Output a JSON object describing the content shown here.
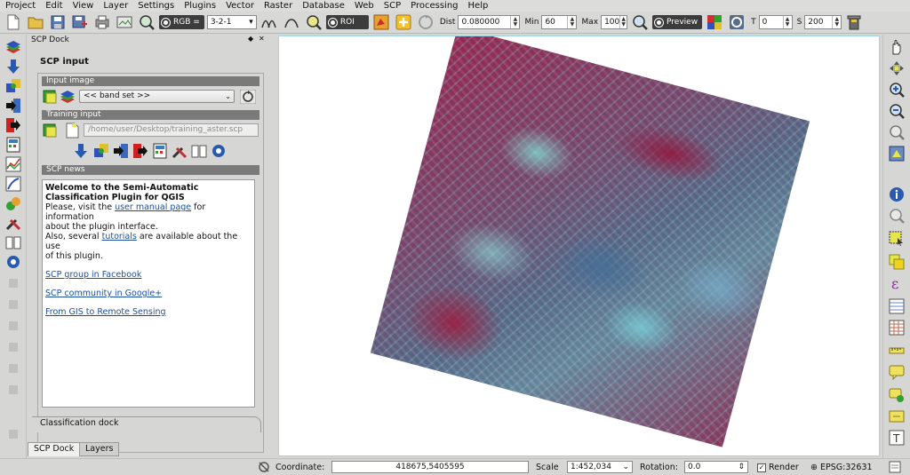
{
  "menu": [
    "Project",
    "Edit",
    "View",
    "Layer",
    "Settings",
    "Plugins",
    "Vector",
    "Raster",
    "Database",
    "Web",
    "SCP",
    "Processing",
    "Help"
  ],
  "toolbar": {
    "rgb_label": "RGB =",
    "rgb_value": "3-2-1",
    "roi_label": "ROI",
    "dist_label": "Dist",
    "dist_value": "0.080000",
    "min_label": "Min",
    "min_value": "60",
    "max_label": "Max",
    "max_value": "100",
    "preview_label": "Preview",
    "t_label": "T",
    "t_value": "0",
    "s_label": "S",
    "s_value": "200"
  },
  "dock": {
    "title": "SCP Dock",
    "float_symbol": "◆",
    "close_symbol": "✕",
    "scp_input_title": "SCP input",
    "input_image_header": "Input image",
    "band_set_value": "<< band set >>",
    "training_input_header": "Training input",
    "training_path": "/home/user/Desktop/training_aster.scp",
    "scp_news_header": "SCP news",
    "news": {
      "welcome_line1": "Welcome to the Semi-Automatic",
      "welcome_line2": "Classification Plugin for QGIS",
      "please_visit": "Please, visit the ",
      "user_manual_link": "user manual page",
      "for_info": " for information",
      "about_interface": "about the plugin interface.",
      "also_several": "Also, several ",
      "tutorials_link": "tutorials",
      "available_about": " are available about the use",
      "of_plugin": "of this plugin.",
      "facebook_link": "SCP group in Facebook",
      "google_link": "SCP community in Google+",
      "gis_link": "From GIS to Remote Sensing"
    },
    "classification_tab": "Classification dock"
  },
  "bottom_tabs": [
    "SCP Dock",
    "Layers"
  ],
  "statusbar": {
    "coordinate_label": "Coordinate:",
    "coordinate_value": "418675,5405595",
    "scale_label": "Scale",
    "scale_value": "1:452,034",
    "rotation_label": "Rotation:",
    "rotation_value": "0.0",
    "render_label": "Render",
    "crs_label": "EPSG:32631"
  },
  "colors": {
    "accent_cyan": "#9fd4e6",
    "section_header": "#7a7a7a",
    "link": "#1a4fa0",
    "vegetation_red": "#b0204a",
    "urban_cyan": "#8ad8d6"
  },
  "icons": {
    "left_toolbar": [
      "layers-stack-icon",
      "download-arrow-icon",
      "band-tools-icon",
      "import-icon",
      "export-icon",
      "calculator-icon",
      "spectral-plot-icon",
      "scatter-plot-icon",
      "classification-icon",
      "tools-icon",
      "book-icon",
      "settings-gear-icon"
    ],
    "right_toolbar": [
      "pan-hand-icon",
      "pan-to-selection-icon",
      "zoom-in-icon",
      "zoom-out-icon",
      "zoom-full-icon",
      "zoom-layer-icon",
      "identify-icon",
      "zoom-last-icon",
      "select-icon",
      "deselect-icon",
      "expression-icon",
      "attribute-table-icon",
      "field-calculator-icon",
      "measure-icon",
      "map-tips-icon",
      "annotation-icon",
      "bookmark-icon",
      "text-annotation-icon"
    ]
  }
}
